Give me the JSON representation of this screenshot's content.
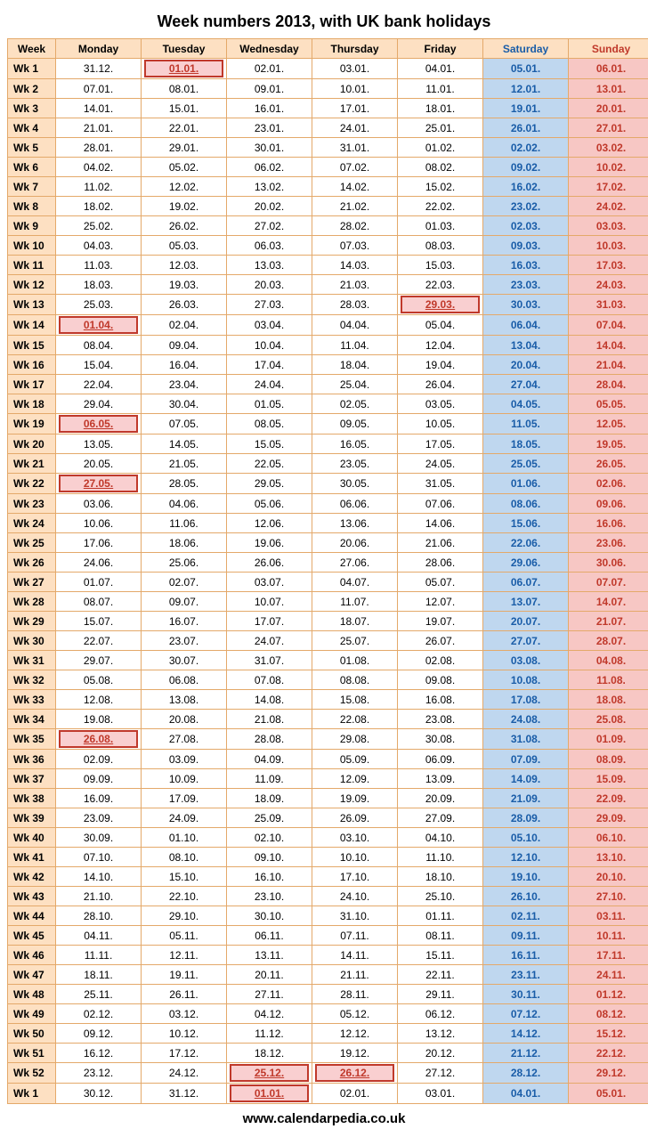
{
  "title": "Week numbers 2013, with UK bank holidays",
  "footer": "www.calendarpedia.co.uk",
  "headers": [
    "Week",
    "Monday",
    "Tuesday",
    "Wednesday",
    "Thursday",
    "Friday",
    "Saturday",
    "Sunday"
  ],
  "rows": [
    {
      "wk": "Wk 1",
      "d": [
        {
          "v": "31.12."
        },
        {
          "v": "01.01.",
          "h": true
        },
        {
          "v": "02.01."
        },
        {
          "v": "03.01."
        },
        {
          "v": "04.01."
        },
        {
          "v": "05.01."
        },
        {
          "v": "06.01."
        }
      ]
    },
    {
      "wk": "Wk 2",
      "d": [
        {
          "v": "07.01."
        },
        {
          "v": "08.01."
        },
        {
          "v": "09.01."
        },
        {
          "v": "10.01."
        },
        {
          "v": "11.01."
        },
        {
          "v": "12.01."
        },
        {
          "v": "13.01."
        }
      ]
    },
    {
      "wk": "Wk 3",
      "d": [
        {
          "v": "14.01."
        },
        {
          "v": "15.01."
        },
        {
          "v": "16.01."
        },
        {
          "v": "17.01."
        },
        {
          "v": "18.01."
        },
        {
          "v": "19.01."
        },
        {
          "v": "20.01."
        }
      ]
    },
    {
      "wk": "Wk 4",
      "d": [
        {
          "v": "21.01."
        },
        {
          "v": "22.01."
        },
        {
          "v": "23.01."
        },
        {
          "v": "24.01."
        },
        {
          "v": "25.01."
        },
        {
          "v": "26.01."
        },
        {
          "v": "27.01."
        }
      ]
    },
    {
      "wk": "Wk 5",
      "d": [
        {
          "v": "28.01."
        },
        {
          "v": "29.01."
        },
        {
          "v": "30.01."
        },
        {
          "v": "31.01."
        },
        {
          "v": "01.02."
        },
        {
          "v": "02.02."
        },
        {
          "v": "03.02."
        }
      ]
    },
    {
      "wk": "Wk 6",
      "d": [
        {
          "v": "04.02."
        },
        {
          "v": "05.02."
        },
        {
          "v": "06.02."
        },
        {
          "v": "07.02."
        },
        {
          "v": "08.02."
        },
        {
          "v": "09.02."
        },
        {
          "v": "10.02."
        }
      ]
    },
    {
      "wk": "Wk 7",
      "d": [
        {
          "v": "11.02."
        },
        {
          "v": "12.02."
        },
        {
          "v": "13.02."
        },
        {
          "v": "14.02."
        },
        {
          "v": "15.02."
        },
        {
          "v": "16.02."
        },
        {
          "v": "17.02."
        }
      ]
    },
    {
      "wk": "Wk 8",
      "d": [
        {
          "v": "18.02."
        },
        {
          "v": "19.02."
        },
        {
          "v": "20.02."
        },
        {
          "v": "21.02."
        },
        {
          "v": "22.02."
        },
        {
          "v": "23.02."
        },
        {
          "v": "24.02."
        }
      ]
    },
    {
      "wk": "Wk 9",
      "d": [
        {
          "v": "25.02."
        },
        {
          "v": "26.02."
        },
        {
          "v": "27.02."
        },
        {
          "v": "28.02."
        },
        {
          "v": "01.03."
        },
        {
          "v": "02.03."
        },
        {
          "v": "03.03."
        }
      ]
    },
    {
      "wk": "Wk 10",
      "d": [
        {
          "v": "04.03."
        },
        {
          "v": "05.03."
        },
        {
          "v": "06.03."
        },
        {
          "v": "07.03."
        },
        {
          "v": "08.03."
        },
        {
          "v": "09.03."
        },
        {
          "v": "10.03."
        }
      ]
    },
    {
      "wk": "Wk 11",
      "d": [
        {
          "v": "11.03."
        },
        {
          "v": "12.03."
        },
        {
          "v": "13.03."
        },
        {
          "v": "14.03."
        },
        {
          "v": "15.03."
        },
        {
          "v": "16.03."
        },
        {
          "v": "17.03."
        }
      ]
    },
    {
      "wk": "Wk 12",
      "d": [
        {
          "v": "18.03."
        },
        {
          "v": "19.03."
        },
        {
          "v": "20.03."
        },
        {
          "v": "21.03."
        },
        {
          "v": "22.03."
        },
        {
          "v": "23.03."
        },
        {
          "v": "24.03."
        }
      ]
    },
    {
      "wk": "Wk 13",
      "d": [
        {
          "v": "25.03."
        },
        {
          "v": "26.03."
        },
        {
          "v": "27.03."
        },
        {
          "v": "28.03."
        },
        {
          "v": "29.03.",
          "h": true
        },
        {
          "v": "30.03."
        },
        {
          "v": "31.03."
        }
      ]
    },
    {
      "wk": "Wk 14",
      "d": [
        {
          "v": "01.04.",
          "h": true
        },
        {
          "v": "02.04."
        },
        {
          "v": "03.04."
        },
        {
          "v": "04.04."
        },
        {
          "v": "05.04."
        },
        {
          "v": "06.04."
        },
        {
          "v": "07.04."
        }
      ]
    },
    {
      "wk": "Wk 15",
      "d": [
        {
          "v": "08.04."
        },
        {
          "v": "09.04."
        },
        {
          "v": "10.04."
        },
        {
          "v": "11.04."
        },
        {
          "v": "12.04."
        },
        {
          "v": "13.04."
        },
        {
          "v": "14.04."
        }
      ]
    },
    {
      "wk": "Wk 16",
      "d": [
        {
          "v": "15.04."
        },
        {
          "v": "16.04."
        },
        {
          "v": "17.04."
        },
        {
          "v": "18.04."
        },
        {
          "v": "19.04."
        },
        {
          "v": "20.04."
        },
        {
          "v": "21.04."
        }
      ]
    },
    {
      "wk": "Wk 17",
      "d": [
        {
          "v": "22.04."
        },
        {
          "v": "23.04."
        },
        {
          "v": "24.04."
        },
        {
          "v": "25.04."
        },
        {
          "v": "26.04."
        },
        {
          "v": "27.04."
        },
        {
          "v": "28.04."
        }
      ]
    },
    {
      "wk": "Wk 18",
      "d": [
        {
          "v": "29.04."
        },
        {
          "v": "30.04."
        },
        {
          "v": "01.05."
        },
        {
          "v": "02.05."
        },
        {
          "v": "03.05."
        },
        {
          "v": "04.05."
        },
        {
          "v": "05.05."
        }
      ]
    },
    {
      "wk": "Wk 19",
      "d": [
        {
          "v": "06.05.",
          "h": true
        },
        {
          "v": "07.05."
        },
        {
          "v": "08.05."
        },
        {
          "v": "09.05."
        },
        {
          "v": "10.05."
        },
        {
          "v": "11.05."
        },
        {
          "v": "12.05."
        }
      ]
    },
    {
      "wk": "Wk 20",
      "d": [
        {
          "v": "13.05."
        },
        {
          "v": "14.05."
        },
        {
          "v": "15.05."
        },
        {
          "v": "16.05."
        },
        {
          "v": "17.05."
        },
        {
          "v": "18.05."
        },
        {
          "v": "19.05."
        }
      ]
    },
    {
      "wk": "Wk 21",
      "d": [
        {
          "v": "20.05."
        },
        {
          "v": "21.05."
        },
        {
          "v": "22.05."
        },
        {
          "v": "23.05."
        },
        {
          "v": "24.05."
        },
        {
          "v": "25.05."
        },
        {
          "v": "26.05."
        }
      ]
    },
    {
      "wk": "Wk 22",
      "d": [
        {
          "v": "27.05.",
          "h": true
        },
        {
          "v": "28.05."
        },
        {
          "v": "29.05."
        },
        {
          "v": "30.05."
        },
        {
          "v": "31.05."
        },
        {
          "v": "01.06."
        },
        {
          "v": "02.06."
        }
      ]
    },
    {
      "wk": "Wk 23",
      "d": [
        {
          "v": "03.06."
        },
        {
          "v": "04.06."
        },
        {
          "v": "05.06."
        },
        {
          "v": "06.06."
        },
        {
          "v": "07.06."
        },
        {
          "v": "08.06."
        },
        {
          "v": "09.06."
        }
      ]
    },
    {
      "wk": "Wk 24",
      "d": [
        {
          "v": "10.06."
        },
        {
          "v": "11.06."
        },
        {
          "v": "12.06."
        },
        {
          "v": "13.06."
        },
        {
          "v": "14.06."
        },
        {
          "v": "15.06."
        },
        {
          "v": "16.06."
        }
      ]
    },
    {
      "wk": "Wk 25",
      "d": [
        {
          "v": "17.06."
        },
        {
          "v": "18.06."
        },
        {
          "v": "19.06."
        },
        {
          "v": "20.06."
        },
        {
          "v": "21.06."
        },
        {
          "v": "22.06."
        },
        {
          "v": "23.06."
        }
      ]
    },
    {
      "wk": "Wk 26",
      "d": [
        {
          "v": "24.06."
        },
        {
          "v": "25.06."
        },
        {
          "v": "26.06."
        },
        {
          "v": "27.06."
        },
        {
          "v": "28.06."
        },
        {
          "v": "29.06."
        },
        {
          "v": "30.06."
        }
      ]
    },
    {
      "wk": "Wk 27",
      "d": [
        {
          "v": "01.07."
        },
        {
          "v": "02.07."
        },
        {
          "v": "03.07."
        },
        {
          "v": "04.07."
        },
        {
          "v": "05.07."
        },
        {
          "v": "06.07."
        },
        {
          "v": "07.07."
        }
      ]
    },
    {
      "wk": "Wk 28",
      "d": [
        {
          "v": "08.07."
        },
        {
          "v": "09.07."
        },
        {
          "v": "10.07."
        },
        {
          "v": "11.07."
        },
        {
          "v": "12.07."
        },
        {
          "v": "13.07."
        },
        {
          "v": "14.07."
        }
      ]
    },
    {
      "wk": "Wk 29",
      "d": [
        {
          "v": "15.07."
        },
        {
          "v": "16.07."
        },
        {
          "v": "17.07."
        },
        {
          "v": "18.07."
        },
        {
          "v": "19.07."
        },
        {
          "v": "20.07."
        },
        {
          "v": "21.07."
        }
      ]
    },
    {
      "wk": "Wk 30",
      "d": [
        {
          "v": "22.07."
        },
        {
          "v": "23.07."
        },
        {
          "v": "24.07."
        },
        {
          "v": "25.07."
        },
        {
          "v": "26.07."
        },
        {
          "v": "27.07."
        },
        {
          "v": "28.07."
        }
      ]
    },
    {
      "wk": "Wk 31",
      "d": [
        {
          "v": "29.07."
        },
        {
          "v": "30.07."
        },
        {
          "v": "31.07."
        },
        {
          "v": "01.08."
        },
        {
          "v": "02.08."
        },
        {
          "v": "03.08."
        },
        {
          "v": "04.08."
        }
      ]
    },
    {
      "wk": "Wk 32",
      "d": [
        {
          "v": "05.08."
        },
        {
          "v": "06.08."
        },
        {
          "v": "07.08."
        },
        {
          "v": "08.08."
        },
        {
          "v": "09.08."
        },
        {
          "v": "10.08."
        },
        {
          "v": "11.08."
        }
      ]
    },
    {
      "wk": "Wk 33",
      "d": [
        {
          "v": "12.08."
        },
        {
          "v": "13.08."
        },
        {
          "v": "14.08."
        },
        {
          "v": "15.08."
        },
        {
          "v": "16.08."
        },
        {
          "v": "17.08."
        },
        {
          "v": "18.08."
        }
      ]
    },
    {
      "wk": "Wk 34",
      "d": [
        {
          "v": "19.08."
        },
        {
          "v": "20.08."
        },
        {
          "v": "21.08."
        },
        {
          "v": "22.08."
        },
        {
          "v": "23.08."
        },
        {
          "v": "24.08."
        },
        {
          "v": "25.08."
        }
      ]
    },
    {
      "wk": "Wk 35",
      "d": [
        {
          "v": "26.08.",
          "h": true
        },
        {
          "v": "27.08."
        },
        {
          "v": "28.08."
        },
        {
          "v": "29.08."
        },
        {
          "v": "30.08."
        },
        {
          "v": "31.08."
        },
        {
          "v": "01.09."
        }
      ]
    },
    {
      "wk": "Wk 36",
      "d": [
        {
          "v": "02.09."
        },
        {
          "v": "03.09."
        },
        {
          "v": "04.09."
        },
        {
          "v": "05.09."
        },
        {
          "v": "06.09."
        },
        {
          "v": "07.09."
        },
        {
          "v": "08.09."
        }
      ]
    },
    {
      "wk": "Wk 37",
      "d": [
        {
          "v": "09.09."
        },
        {
          "v": "10.09."
        },
        {
          "v": "11.09."
        },
        {
          "v": "12.09."
        },
        {
          "v": "13.09."
        },
        {
          "v": "14.09."
        },
        {
          "v": "15.09."
        }
      ]
    },
    {
      "wk": "Wk 38",
      "d": [
        {
          "v": "16.09."
        },
        {
          "v": "17.09."
        },
        {
          "v": "18.09."
        },
        {
          "v": "19.09."
        },
        {
          "v": "20.09."
        },
        {
          "v": "21.09."
        },
        {
          "v": "22.09."
        }
      ]
    },
    {
      "wk": "Wk 39",
      "d": [
        {
          "v": "23.09."
        },
        {
          "v": "24.09."
        },
        {
          "v": "25.09."
        },
        {
          "v": "26.09."
        },
        {
          "v": "27.09."
        },
        {
          "v": "28.09."
        },
        {
          "v": "29.09."
        }
      ]
    },
    {
      "wk": "Wk 40",
      "d": [
        {
          "v": "30.09."
        },
        {
          "v": "01.10."
        },
        {
          "v": "02.10."
        },
        {
          "v": "03.10."
        },
        {
          "v": "04.10."
        },
        {
          "v": "05.10."
        },
        {
          "v": "06.10."
        }
      ]
    },
    {
      "wk": "Wk 41",
      "d": [
        {
          "v": "07.10."
        },
        {
          "v": "08.10."
        },
        {
          "v": "09.10."
        },
        {
          "v": "10.10."
        },
        {
          "v": "11.10."
        },
        {
          "v": "12.10."
        },
        {
          "v": "13.10."
        }
      ]
    },
    {
      "wk": "Wk 42",
      "d": [
        {
          "v": "14.10."
        },
        {
          "v": "15.10."
        },
        {
          "v": "16.10."
        },
        {
          "v": "17.10."
        },
        {
          "v": "18.10."
        },
        {
          "v": "19.10."
        },
        {
          "v": "20.10."
        }
      ]
    },
    {
      "wk": "Wk 43",
      "d": [
        {
          "v": "21.10."
        },
        {
          "v": "22.10."
        },
        {
          "v": "23.10."
        },
        {
          "v": "24.10."
        },
        {
          "v": "25.10."
        },
        {
          "v": "26.10."
        },
        {
          "v": "27.10."
        }
      ]
    },
    {
      "wk": "Wk 44",
      "d": [
        {
          "v": "28.10."
        },
        {
          "v": "29.10."
        },
        {
          "v": "30.10."
        },
        {
          "v": "31.10."
        },
        {
          "v": "01.11."
        },
        {
          "v": "02.11."
        },
        {
          "v": "03.11."
        }
      ]
    },
    {
      "wk": "Wk 45",
      "d": [
        {
          "v": "04.11."
        },
        {
          "v": "05.11."
        },
        {
          "v": "06.11."
        },
        {
          "v": "07.11."
        },
        {
          "v": "08.11."
        },
        {
          "v": "09.11."
        },
        {
          "v": "10.11."
        }
      ]
    },
    {
      "wk": "Wk 46",
      "d": [
        {
          "v": "11.11."
        },
        {
          "v": "12.11."
        },
        {
          "v": "13.11."
        },
        {
          "v": "14.11."
        },
        {
          "v": "15.11."
        },
        {
          "v": "16.11."
        },
        {
          "v": "17.11."
        }
      ]
    },
    {
      "wk": "Wk 47",
      "d": [
        {
          "v": "18.11."
        },
        {
          "v": "19.11."
        },
        {
          "v": "20.11."
        },
        {
          "v": "21.11."
        },
        {
          "v": "22.11."
        },
        {
          "v": "23.11."
        },
        {
          "v": "24.11."
        }
      ]
    },
    {
      "wk": "Wk 48",
      "d": [
        {
          "v": "25.11."
        },
        {
          "v": "26.11."
        },
        {
          "v": "27.11."
        },
        {
          "v": "28.11."
        },
        {
          "v": "29.11."
        },
        {
          "v": "30.11."
        },
        {
          "v": "01.12."
        }
      ]
    },
    {
      "wk": "Wk 49",
      "d": [
        {
          "v": "02.12."
        },
        {
          "v": "03.12."
        },
        {
          "v": "04.12."
        },
        {
          "v": "05.12."
        },
        {
          "v": "06.12."
        },
        {
          "v": "07.12."
        },
        {
          "v": "08.12."
        }
      ]
    },
    {
      "wk": "Wk 50",
      "d": [
        {
          "v": "09.12."
        },
        {
          "v": "10.12."
        },
        {
          "v": "11.12."
        },
        {
          "v": "12.12."
        },
        {
          "v": "13.12."
        },
        {
          "v": "14.12."
        },
        {
          "v": "15.12."
        }
      ]
    },
    {
      "wk": "Wk 51",
      "d": [
        {
          "v": "16.12."
        },
        {
          "v": "17.12."
        },
        {
          "v": "18.12."
        },
        {
          "v": "19.12."
        },
        {
          "v": "20.12."
        },
        {
          "v": "21.12."
        },
        {
          "v": "22.12."
        }
      ]
    },
    {
      "wk": "Wk 52",
      "d": [
        {
          "v": "23.12."
        },
        {
          "v": "24.12."
        },
        {
          "v": "25.12.",
          "h": true
        },
        {
          "v": "26.12.",
          "h": true
        },
        {
          "v": "27.12."
        },
        {
          "v": "28.12."
        },
        {
          "v": "29.12."
        }
      ]
    },
    {
      "wk": "Wk 1",
      "d": [
        {
          "v": "30.12."
        },
        {
          "v": "31.12."
        },
        {
          "v": "01.01.",
          "h": true
        },
        {
          "v": "02.01."
        },
        {
          "v": "03.01."
        },
        {
          "v": "04.01."
        },
        {
          "v": "05.01."
        }
      ]
    }
  ]
}
